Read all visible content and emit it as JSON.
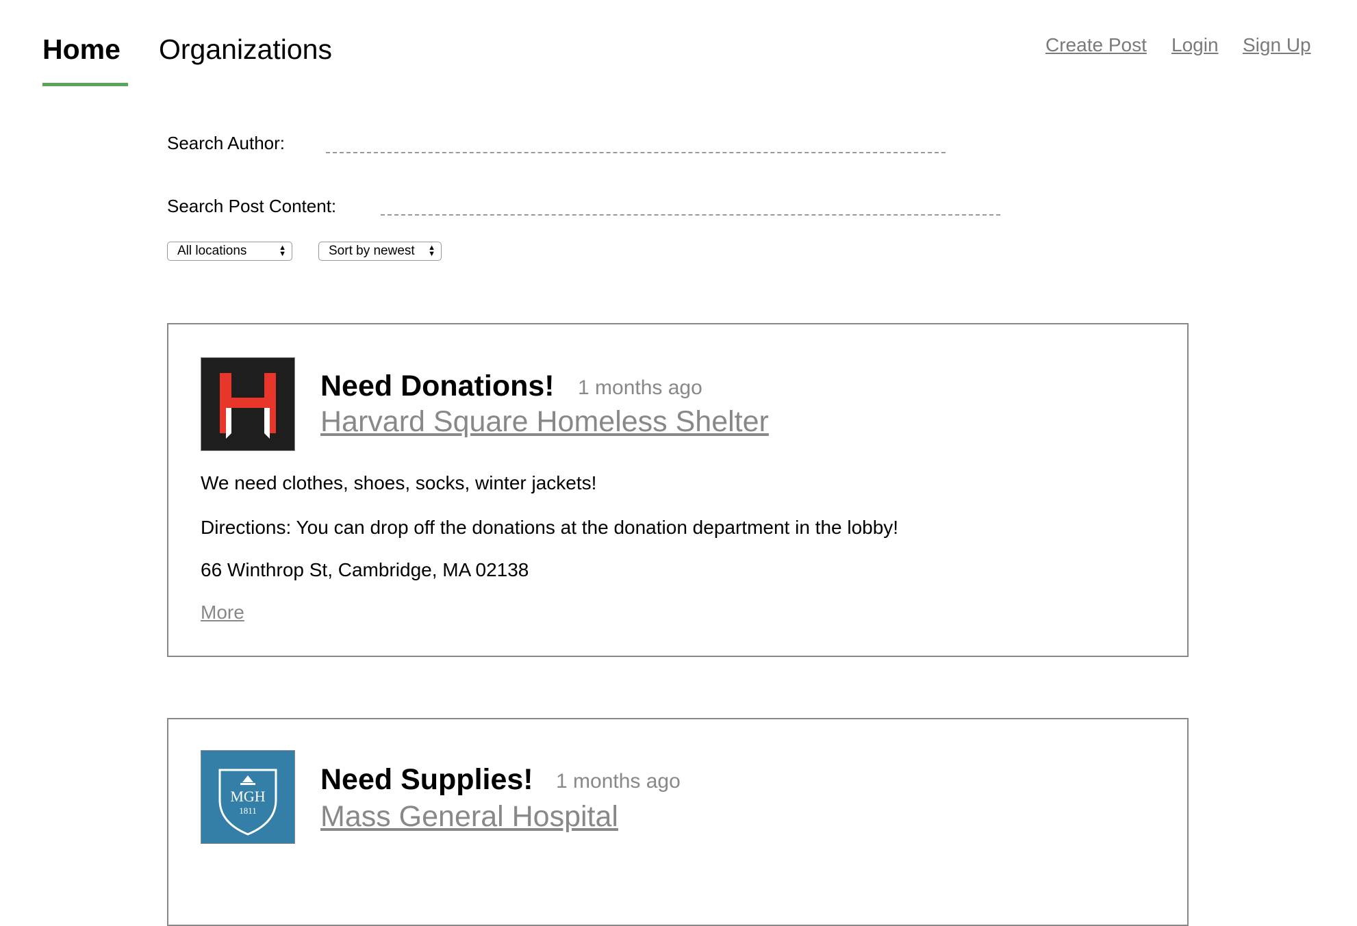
{
  "nav": {
    "home": "Home",
    "organizations": "Organizations",
    "active_color": "#5aa55c"
  },
  "top_links": {
    "create_post": "Create Post",
    "login": "Login",
    "sign_up": "Sign Up"
  },
  "filters": {
    "search_author_label": "Search Author:",
    "search_author_value": "",
    "search_content_label": "Search Post Content:",
    "search_content_value": "",
    "location_select": "All locations",
    "sort_select": "Sort by newest"
  },
  "posts": [
    {
      "title": "Need Donations!",
      "time": "1 months ago",
      "organization": "Harvard Square Homeless Shelter",
      "logo": "harvard-square-shelter-logo",
      "body": "We need clothes, shoes, socks, winter jackets!",
      "directions": "Directions: You can drop off the donations at the donation department in the lobby!",
      "address": "66 Winthrop St, Cambridge, MA 02138",
      "more": "More"
    },
    {
      "title": "Need Supplies!",
      "time": "1 months ago",
      "organization": "Mass General Hospital",
      "logo": "mgh-logo",
      "logo_text": "MGH",
      "logo_year": "1811"
    }
  ]
}
